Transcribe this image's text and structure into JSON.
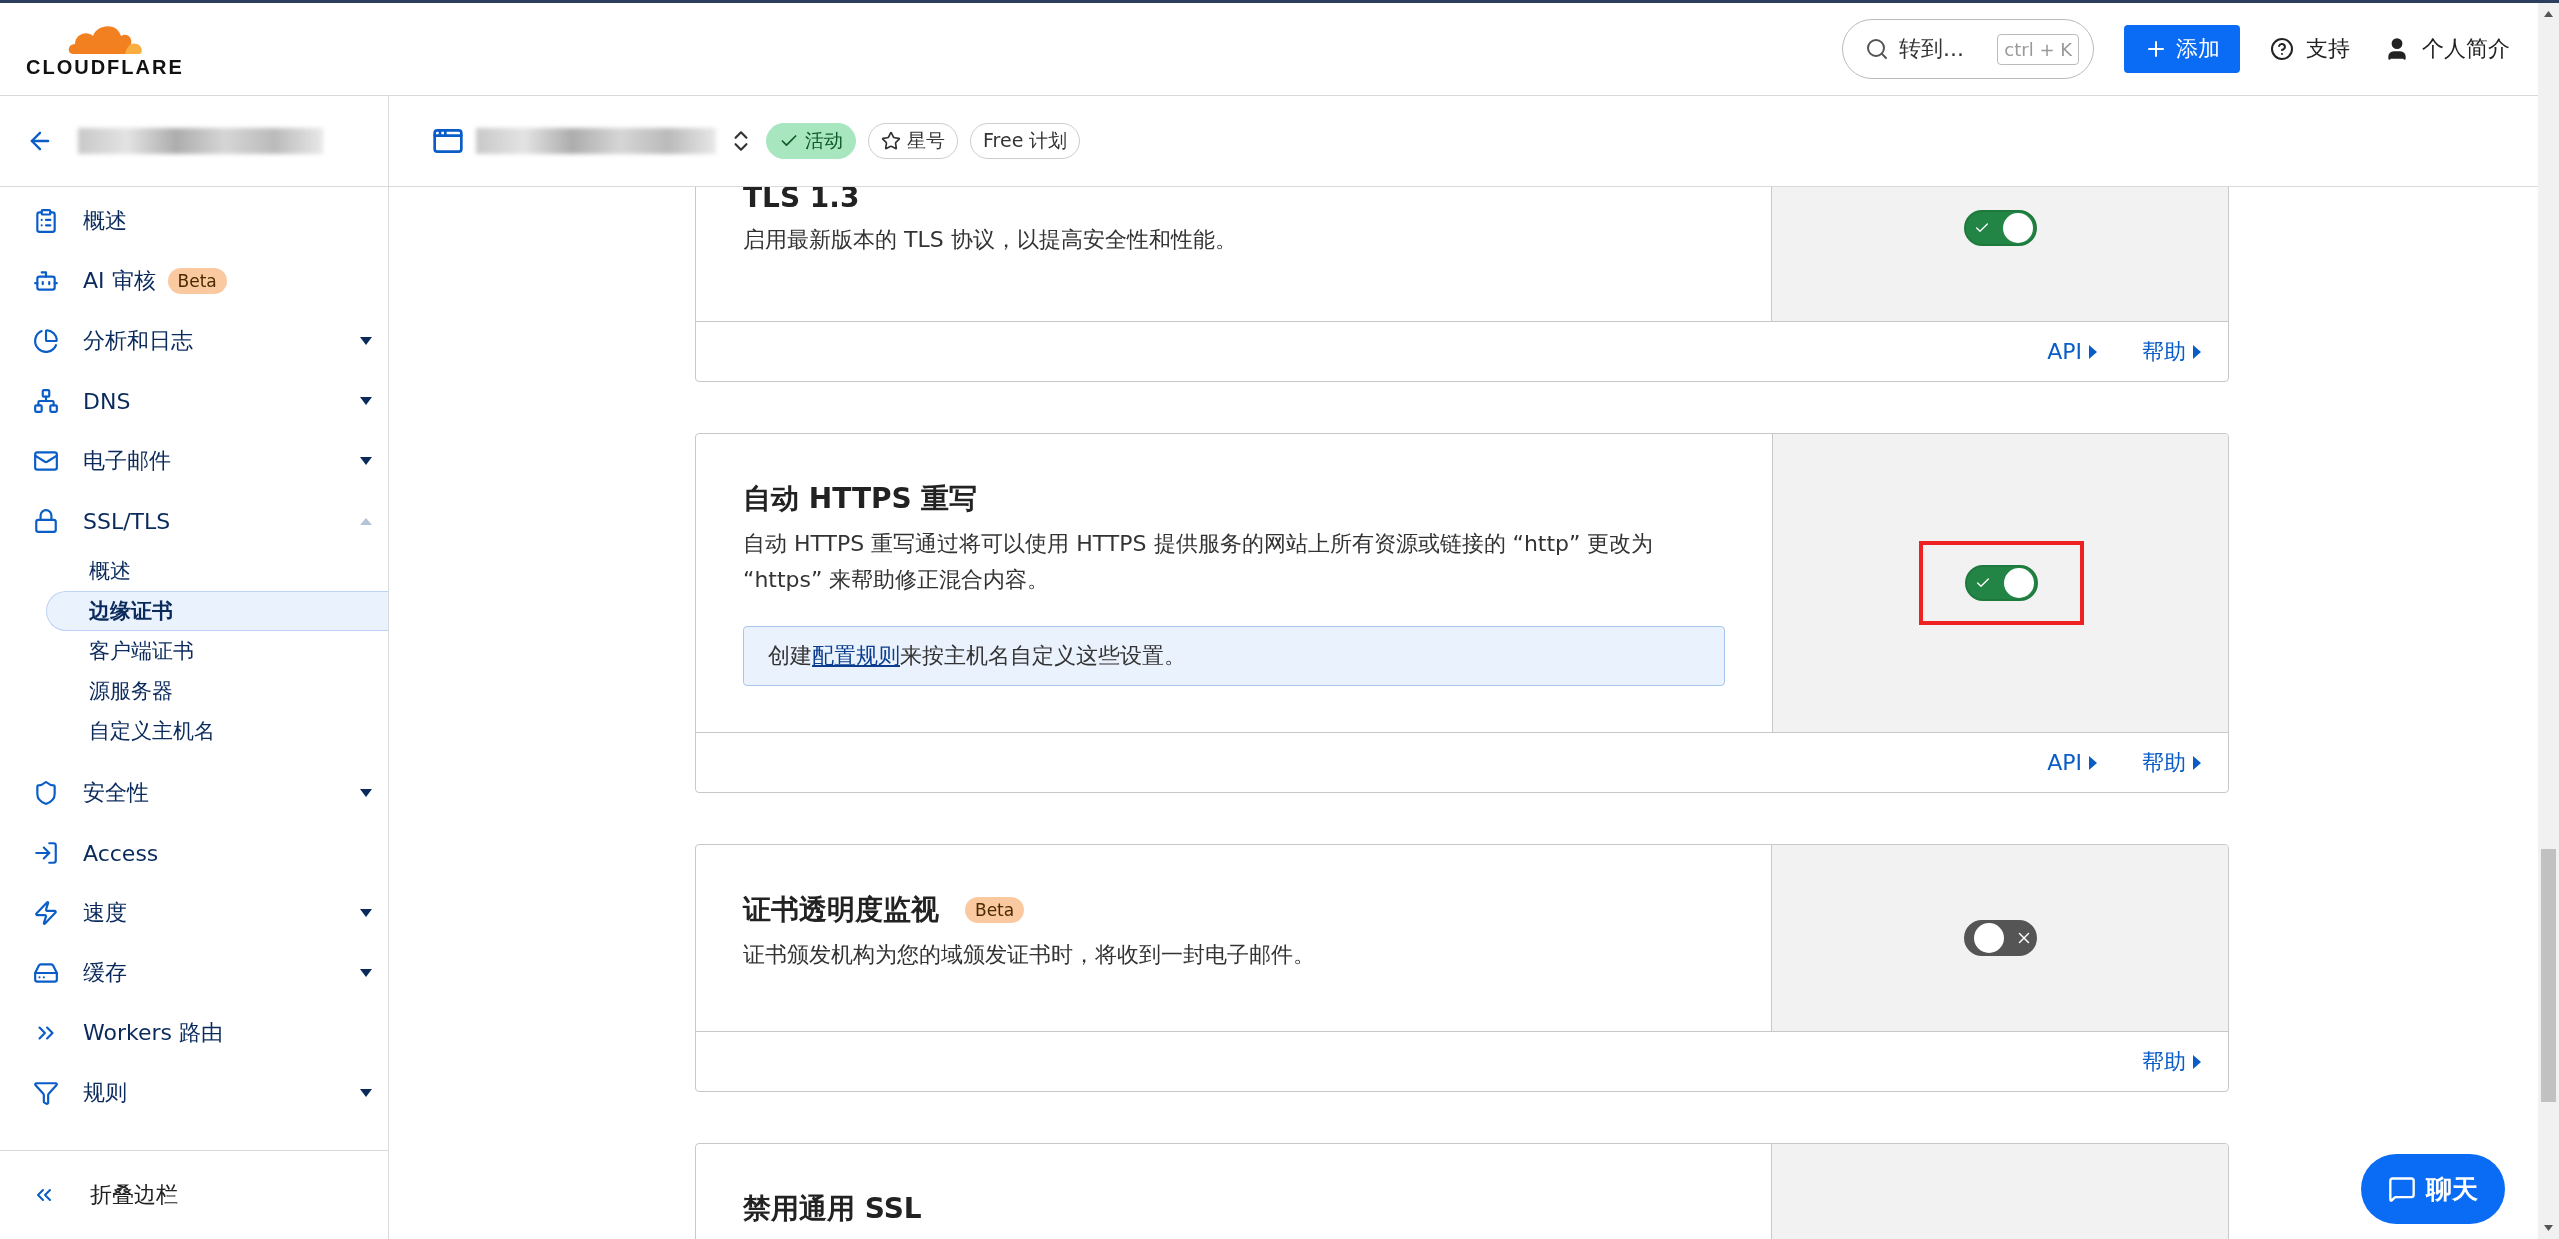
{
  "header": {
    "logo": "CLOUDFLARE",
    "search": {
      "placeholder": "转到...",
      "shortcut": "ctrl + K"
    },
    "add_button": "添加",
    "support": "支持",
    "profile": "个人简介"
  },
  "zone_bar": {
    "badges": [
      {
        "label": "活动",
        "kind": "status"
      },
      {
        "label": "星号",
        "kind": "star"
      },
      {
        "label": "Free 计划",
        "kind": "plan"
      }
    ]
  },
  "sidebar": {
    "items": [
      {
        "label": "概述"
      },
      {
        "label": "AI 审核",
        "badge": "Beta"
      },
      {
        "label": "分析和日志",
        "expanded": false
      },
      {
        "label": "DNS",
        "expanded": false
      },
      {
        "label": "电子邮件",
        "expanded": false
      },
      {
        "label": "SSL/TLS",
        "expanded": true,
        "children": [
          {
            "label": "概述",
            "selected": false
          },
          {
            "label": "边缘证书",
            "selected": true
          },
          {
            "label": "客户端证书",
            "selected": false
          },
          {
            "label": "源服务器",
            "selected": false
          },
          {
            "label": "自定义主机名",
            "selected": false
          }
        ]
      },
      {
        "label": "安全性",
        "expanded": false
      },
      {
        "label": "Access"
      },
      {
        "label": "速度",
        "expanded": false
      },
      {
        "label": "缓存",
        "expanded": false
      },
      {
        "label": "Workers 路由"
      },
      {
        "label": "规则",
        "expanded": false
      }
    ],
    "collapse": "折叠边栏"
  },
  "cards": [
    {
      "title": "TLS 1.3",
      "description": "启用最新版本的 TLS 协议，以提高安全性和性能。",
      "on": true,
      "highlighted": false,
      "links": [
        "API",
        "帮助"
      ]
    },
    {
      "title": "自动 HTTPS 重写",
      "description": "自动 HTTPS 重写通过将可以使用 HTTPS 提供服务的网站上所有资源或链接的 “http” 更改为 “https” 来帮助修正混合内容。",
      "note": {
        "before": "创建",
        "link": "配置规则",
        "after": "来按主机名自定义这些设置。"
      },
      "on": true,
      "highlighted": true,
      "links": [
        "API",
        "帮助"
      ]
    },
    {
      "title": "证书透明度监视",
      "badge": "Beta",
      "description": "证书颁发机构为您的域颁发证书时，将收到一封电子邮件。",
      "on": false,
      "highlighted": false,
      "links": [
        "帮助"
      ]
    },
    {
      "title": "禁用通用 SSL"
    }
  ],
  "chat_button": "聊天"
}
